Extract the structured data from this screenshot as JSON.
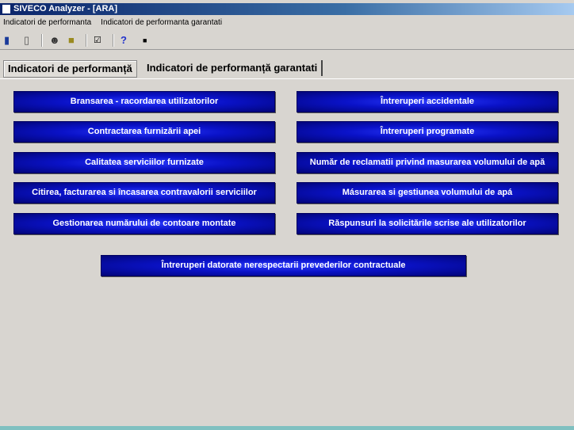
{
  "window": {
    "title": "SIVECO Analyzer - [ARA]"
  },
  "menu": [
    "Indicatori de performanta",
    "Indicatori de performanta garantati"
  ],
  "toolbar": {
    "icons": [
      "book-icon",
      "trash-icon",
      "user-icon",
      "lock-icon",
      "checkbox-icon",
      "help-icon",
      "stop-icon"
    ],
    "help_glyph": "?"
  },
  "tabs": [
    {
      "label": "Indicatori de performanță",
      "active": true
    },
    {
      "label": "Indicatori de performanță garantati",
      "active": false
    }
  ],
  "buttons_left": [
    "Bransarea - racordarea utilizatorilor",
    "Contractarea furnizării apei",
    "Calitatea serviciilor furnizate",
    "Citirea, facturarea si încasarea contravalorii serviciilor",
    "Gestionarea numărului de contoare montate"
  ],
  "buttons_right": [
    "Întreruperi accidentale",
    "Întreruperi programate",
    "Număr de reclamatii privind masurarea volumului de apă",
    "Másurarea si gestiunea volumului de apá",
    "Rǎspunsuri la solicitările scrise ale utilizatorilor"
  ],
  "button_bottom": "Întreruperi datorate nerespectarii prevederilor contractuale",
  "colors": {
    "button": "#0a12c8",
    "titlebar": "#0a246a"
  }
}
